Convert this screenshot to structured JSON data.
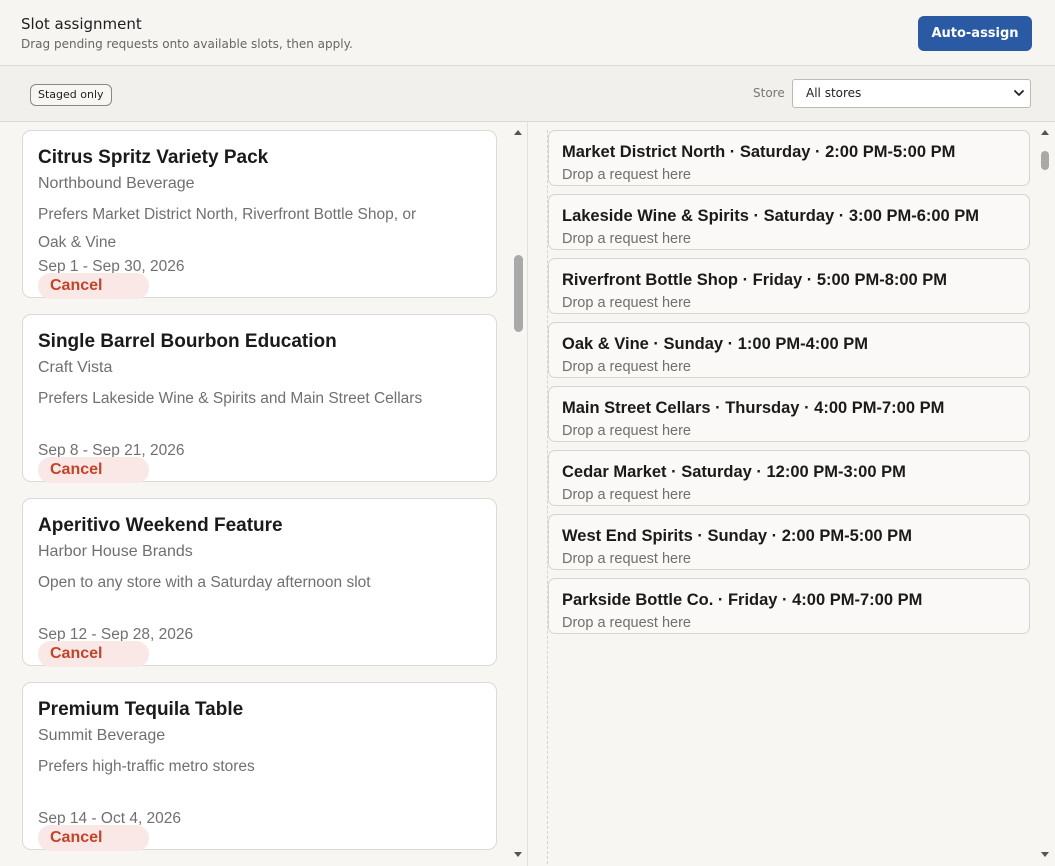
{
  "header": {
    "title": "Slot assignment",
    "subtitle": "Drag pending requests onto available slots, then apply.",
    "auto_assign_label": "Auto-assign"
  },
  "toolbar": {
    "staged_chip": "Staged only",
    "store_label": "Store",
    "store_selected": "All stores"
  },
  "requests": [
    {
      "title": "Citrus Spritz Variety Pack",
      "vendor": "Northbound Beverage",
      "preference": "Prefers Market District North, Riverfront Bottle Shop, or Oak & Vine",
      "dates": "Sep 1 - Sep 30, 2026",
      "cancel_label": "Cancel"
    },
    {
      "title": "Single Barrel Bourbon Education",
      "vendor": "Craft Vista",
      "preference": "Prefers Lakeside Wine & Spirits and Main Street Cellars",
      "dates": "Sep 8 - Sep 21, 2026",
      "cancel_label": "Cancel"
    },
    {
      "title": "Aperitivo Weekend Feature",
      "vendor": "Harbor House Brands",
      "preference": "Open to any store with a Saturday afternoon slot",
      "dates": "Sep 12 - Sep 28, 2026",
      "cancel_label": "Cancel"
    },
    {
      "title": "Premium Tequila Table",
      "vendor": "Summit Beverage",
      "preference": "Prefers high-traffic metro stores",
      "dates": "Sep 14 - Oct 4, 2026",
      "cancel_label": "Cancel"
    }
  ],
  "slots": [
    {
      "title": "Market District North · Saturday · 2:00 PM-5:00 PM",
      "hint": "Drop a request here"
    },
    {
      "title": "Lakeside Wine & Spirits · Saturday · 3:00 PM-6:00 PM",
      "hint": "Drop a request here"
    },
    {
      "title": "Riverfront Bottle Shop · Friday · 5:00 PM-8:00 PM",
      "hint": "Drop a request here"
    },
    {
      "title": "Oak & Vine · Sunday · 1:00 PM-4:00 PM",
      "hint": "Drop a request here"
    },
    {
      "title": "Main Street Cellars · Thursday · 4:00 PM-7:00 PM",
      "hint": "Drop a request here"
    },
    {
      "title": "Cedar Market · Saturday · 12:00 PM-3:00 PM",
      "hint": "Drop a request here"
    },
    {
      "title": "West End Spirits · Sunday · 2:00 PM-5:00 PM",
      "hint": "Drop a request here"
    },
    {
      "title": "Parkside Bottle Co. · Friday · 4:00 PM-7:00 PM",
      "hint": "Drop a request here"
    }
  ],
  "colors": {
    "accent": "#2a5aa4",
    "cancel_text": "#c2442a",
    "cancel_bg": "#f9e8e5"
  }
}
